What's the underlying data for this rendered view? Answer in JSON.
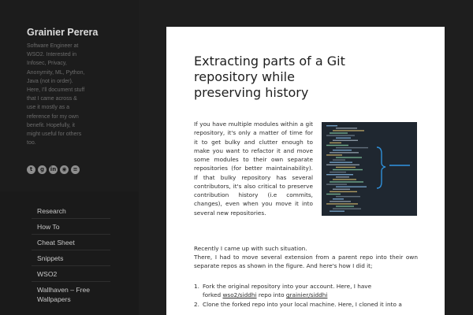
{
  "site": {
    "title": "Grainier Perera",
    "description": "Software Engineer at WSO2. Interested in Infosec, Privacy, Anonymity, ML, Python, Java (not in order). Here, I'll document stuff that I came across & use it mostly as a reference for my own benefit. Hopefully, it might useful for others too."
  },
  "social": [
    {
      "icon": "twitter-icon",
      "glyph": "t"
    },
    {
      "icon": "google-plus-icon",
      "glyph": "g"
    },
    {
      "icon": "linkedin-icon",
      "glyph": "in"
    },
    {
      "icon": "github-icon",
      "glyph": "◉"
    },
    {
      "icon": "stackoverflow-icon",
      "glyph": "≡"
    }
  ],
  "nav": [
    {
      "label": "Research"
    },
    {
      "label": "How To"
    },
    {
      "label": "Cheat Sheet"
    },
    {
      "label": "Snippets"
    },
    {
      "label": "WSO2"
    },
    {
      "label": "Wallhaven – Free Wallpapers"
    }
  ],
  "post": {
    "title": "Extracting parts of a Git repository while preserving history",
    "intro": "If you have multiple modules within a git repository, it's only a matter of time for it to get bulky and clutter enough to make you want to refactor it and move some modules to their own separate repositories (for better maintainability). If that bulky repository has several contributors, it's also critical to preserve contribution history (i.e commits, changes), even when you move it into several new repositories.",
    "situation": "Recently I came up with such situation.",
    "there": "There, I had to move several extension from a parent repo into their own separate repos as shown in the figure. And here's how I did it;",
    "steps": [
      {
        "num": "1.",
        "line1": "Fork the original repository into your account. Here, I have",
        "pre": "forked ",
        "link1": "wso2/siddhi",
        "mid": " repo into ",
        "link2": "grainier/siddhi"
      },
      {
        "num": "2.",
        "line1": "Clone the forked repo into your local machine. Here, I cloned it into a"
      }
    ]
  },
  "colors": {
    "sidebar": "#1a1a1a",
    "card": "#ffffff",
    "figure_bg": "#1f2730",
    "figure_accent": "#2f8fd8"
  }
}
